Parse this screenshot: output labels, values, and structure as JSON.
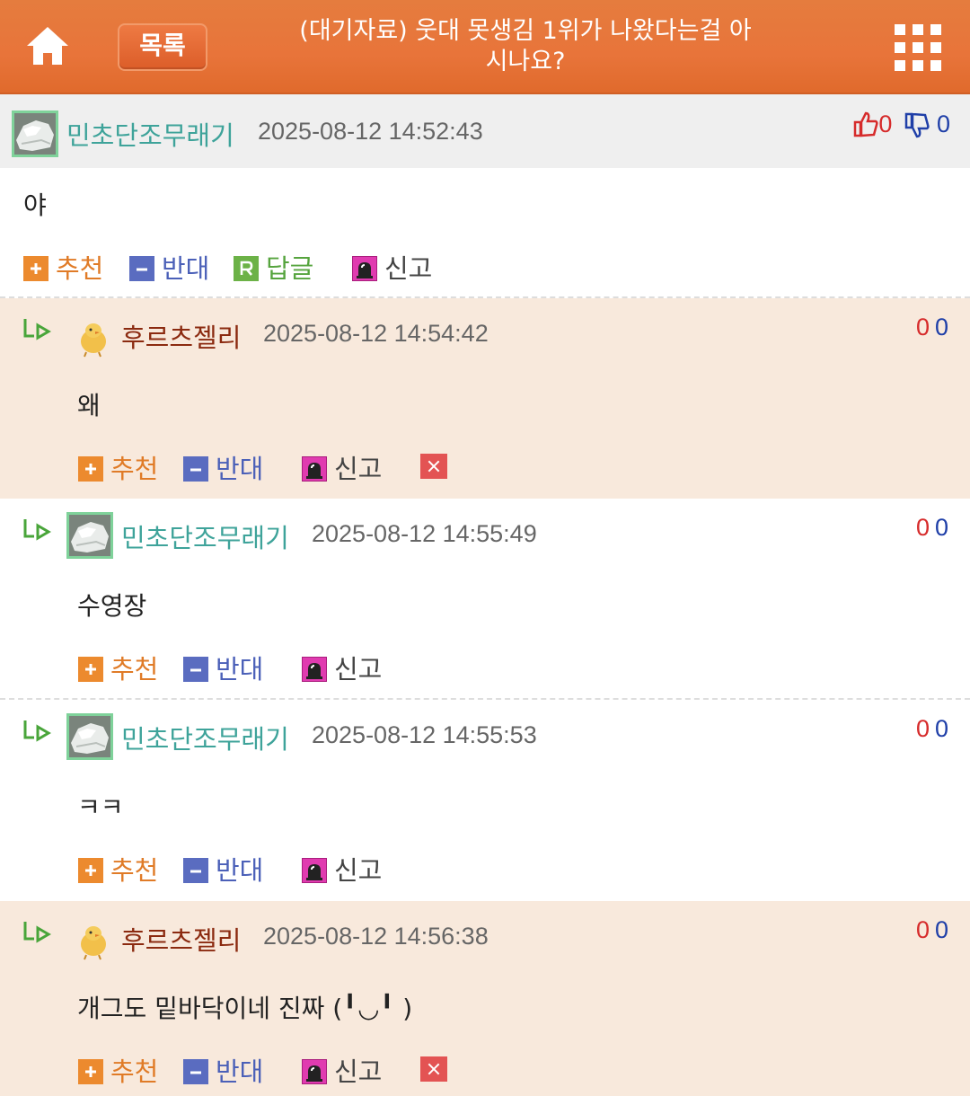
{
  "header": {
    "list_label": "목록",
    "title": "(대기자료) 웃대 못생김 1위가 나왔다는걸 아시나요?",
    "title_line1": "(대기자료) 웃대 못생김 1위가 나왔다는걸 아",
    "title_line2": "시나요?"
  },
  "post": {
    "author": "민초단조무래기",
    "time": "2025-08-12 14:52:43",
    "body": "야",
    "up": "0",
    "down": "0",
    "actions": {
      "recommend": "추천",
      "oppose": "반대",
      "reply": "답글",
      "report": "신고"
    }
  },
  "comments": [
    {
      "author": "후르츠젤리",
      "time": "2025-08-12 14:54:42",
      "body": "왜",
      "up": "0",
      "down": "0",
      "actions": {
        "recommend": "추천",
        "oppose": "반대",
        "report": "신고"
      }
    },
    {
      "author": "민초단조무래기",
      "time": "2025-08-12 14:55:49",
      "body": "수영장",
      "up": "0",
      "down": "0",
      "actions": {
        "recommend": "추천",
        "oppose": "반대",
        "report": "신고"
      }
    },
    {
      "author": "민초단조무래기",
      "time": "2025-08-12 14:55:53",
      "body": "ㅋㅋ",
      "up": "0",
      "down": "0",
      "actions": {
        "recommend": "추천",
        "oppose": "반대",
        "report": "신고"
      }
    },
    {
      "author": "후르츠젤리",
      "time": "2025-08-12 14:56:38",
      "body": "개그도 밑바닥이네 진짜 (╹◡╹ )",
      "up": "0",
      "down": "0",
      "actions": {
        "recommend": "추천",
        "oppose": "반대",
        "report": "신고"
      }
    }
  ],
  "colors": {
    "header": "#e8743a",
    "alt_row": "#f8e9dc",
    "nick_a": "#3ea39a",
    "nick_b": "#8b2a10"
  },
  "icons": [
    "home-icon",
    "grid-menu-icon",
    "thumbs-up-icon",
    "thumbs-down-icon",
    "reply-arrow-icon",
    "plus-icon",
    "minus-icon",
    "r-icon",
    "siren-icon",
    "close-icon"
  ]
}
